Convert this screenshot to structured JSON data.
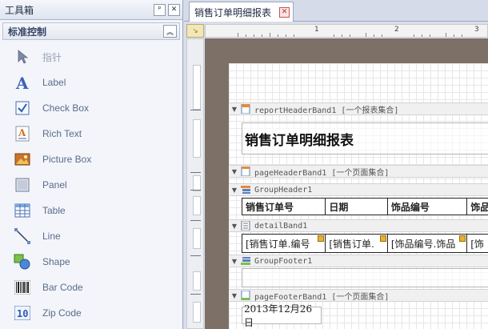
{
  "toolbox": {
    "title": "工具箱",
    "pin_glyph": "ᵖ",
    "close_glyph": "✕",
    "group": {
      "title": "标准控制",
      "collapse_glyph": "︽"
    },
    "items": [
      {
        "label": "指针",
        "icon": "pointer-icon",
        "enabled": false
      },
      {
        "label": "Label",
        "icon": "label-icon",
        "enabled": true
      },
      {
        "label": "Check Box",
        "icon": "checkbox-icon",
        "enabled": true
      },
      {
        "label": "Rich Text",
        "icon": "rich-text-icon",
        "enabled": true
      },
      {
        "label": "Picture Box",
        "icon": "picture-icon",
        "enabled": true
      },
      {
        "label": "Panel",
        "icon": "panel-icon",
        "enabled": true
      },
      {
        "label": "Table",
        "icon": "table-icon",
        "enabled": true
      },
      {
        "label": "Line",
        "icon": "line-icon",
        "enabled": true
      },
      {
        "label": "Shape",
        "icon": "shape-icon",
        "enabled": true
      },
      {
        "label": "Bar Code",
        "icon": "barcode-icon",
        "enabled": true
      },
      {
        "label": "Zip Code",
        "icon": "zipcode-icon",
        "enabled": true
      }
    ]
  },
  "document": {
    "tab_label": "销售订单明细报表",
    "tab_close_glyph": "✕",
    "ruler_corner_glyph": "↘",
    "ruler_numbers": [
      "1",
      "2",
      "3"
    ]
  },
  "report": {
    "bands": [
      {
        "name": "reportHeaderBand1",
        "label": "reportHeaderBand1 [一个报表集合]",
        "icon": "report-header-icon"
      },
      {
        "name": "pageHeaderBand1",
        "label": "pageHeaderBand1 [一个页面集合]",
        "icon": "page-header-icon"
      },
      {
        "name": "GroupHeader1",
        "label": "GroupHeader1",
        "icon": "group-header-icon"
      },
      {
        "name": "detailBand1",
        "label": "detailBand1",
        "icon": "detail-icon"
      },
      {
        "name": "GroupFooter1",
        "label": "GroupFooter1",
        "icon": "group-footer-icon"
      },
      {
        "name": "pageFooterBand1",
        "label": "pageFooterBand1 [一个页面集合]",
        "icon": "page-footer-icon"
      }
    ],
    "title": "销售订单明细报表",
    "header_cells": [
      "销售订单号",
      "日期",
      "饰品编号",
      "饰品"
    ],
    "detail_cells": [
      "[销售订单.编号",
      "[销售订单.",
      "[饰品编号.饰品",
      "[饰"
    ],
    "footer_date": "2013年12月26日"
  },
  "colors": {
    "accent": "#3b5e9c",
    "canvas_bg": "#7d7066",
    "smart_tag": "#e8b22d"
  }
}
